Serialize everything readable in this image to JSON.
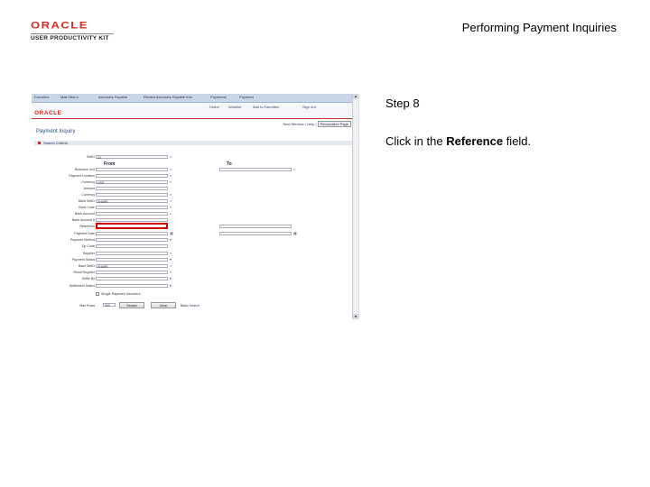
{
  "header": {
    "logo_brand": "ORACLE",
    "logo_kit": "USER PRODUCTIVITY KIT",
    "doc_title": "Performing Payment Inquiries"
  },
  "instructions": {
    "step": "Step 8",
    "text_before": "Click in the ",
    "text_bold": "Reference",
    "text_after": " field."
  },
  "screenshot": {
    "topbar_crumbs": [
      "Favorites",
      "Main Menu",
      "Accounts Payable",
      "Review Accounts Payable Info",
      "Payments",
      "Payment"
    ],
    "secnav": [
      "Home",
      "Worklist",
      "Add to Favorites",
      "Sign out"
    ],
    "brand": "ORACLE",
    "viewbar_links": [
      "New Window",
      "Help"
    ],
    "viewbar_boxed": "Personalize Page",
    "page_title": "Payment Inquiry",
    "criteria_label": "Search Criteria",
    "col_from": "From",
    "col_to": "To",
    "fields": [
      {
        "label": "SetID",
        "value": "A1"
      },
      {
        "label": "Business Unit",
        "value": ""
      },
      {
        "label": "Payment Location",
        "value": ""
      },
      {
        "label": "Currency",
        "value": "USD"
      },
      {
        "label": "Amount",
        "value": ""
      },
      {
        "label": "Currency",
        "value": ""
      },
      {
        "label": "Bank SetID",
        "value": "SHARE"
      },
      {
        "label": "Bank Code",
        "value": ""
      },
      {
        "label": "Bank Account",
        "value": ""
      },
      {
        "label": "Bank Account #",
        "value": ""
      },
      {
        "label": "Reference",
        "value": ""
      },
      {
        "label": "Payment Date",
        "value": ""
      },
      {
        "label": "Payment Method",
        "value": ""
      },
      {
        "label": "Zip Code",
        "value": ""
      },
      {
        "label": "Supplier",
        "value": ""
      },
      {
        "label": "Payment Status",
        "value": ""
      },
      {
        "label": "Bank SetID",
        "value": "SHARE"
      },
      {
        "label": "Remit Supplier",
        "value": ""
      },
      {
        "label": "Settle By",
        "value": ""
      },
      {
        "label": "Settlement Status",
        "value": ""
      }
    ],
    "single_payment_checkbox": "Single Payment Vouchers",
    "max_rows_label": "Max Rows",
    "max_rows_value": "300",
    "search_button": "Search",
    "clear_button": "Clear",
    "basic_search_link": "Basic Search"
  }
}
